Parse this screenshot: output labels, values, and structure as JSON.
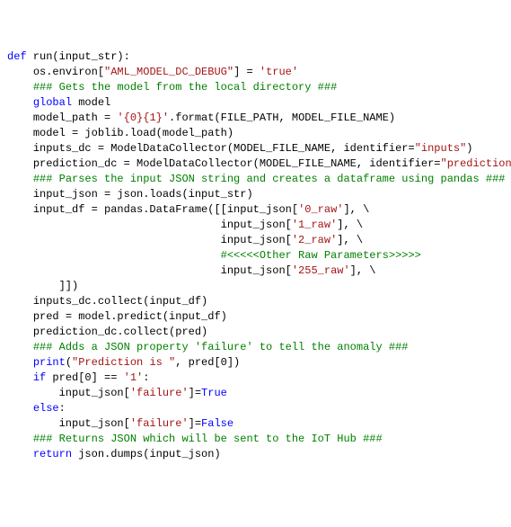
{
  "code": {
    "lines": [
      {
        "indent": 0,
        "segments": [
          {
            "cls": "kw",
            "t": "def"
          },
          {
            "cls": "",
            "t": " run(input_str):"
          }
        ]
      },
      {
        "indent": 1,
        "segments": [
          {
            "cls": "",
            "t": "os.environ["
          },
          {
            "cls": "str",
            "t": "\"AML_MODEL_DC_DEBUG\""
          },
          {
            "cls": "",
            "t": "] = "
          },
          {
            "cls": "str",
            "t": "'true'"
          }
        ]
      },
      {
        "indent": 0,
        "segments": [
          {
            "cls": "",
            "t": ""
          }
        ]
      },
      {
        "indent": 1,
        "segments": [
          {
            "cls": "cmt",
            "t": "### Gets the model from the local directory ###"
          }
        ]
      },
      {
        "indent": 1,
        "segments": [
          {
            "cls": "kw",
            "t": "global"
          },
          {
            "cls": "",
            "t": " model"
          }
        ]
      },
      {
        "indent": 1,
        "segments": [
          {
            "cls": "",
            "t": "model_path = "
          },
          {
            "cls": "str",
            "t": "'{0}{1}'"
          },
          {
            "cls": "",
            "t": ".format(FILE_PATH, MODEL_FILE_NAME)"
          }
        ]
      },
      {
        "indent": 1,
        "segments": [
          {
            "cls": "",
            "t": "model = joblib.load(model_path)"
          }
        ]
      },
      {
        "indent": 1,
        "segments": [
          {
            "cls": "",
            "t": "inputs_dc = ModelDataCollector(MODEL_FILE_NAME, identifier="
          },
          {
            "cls": "str",
            "t": "\"inputs\""
          },
          {
            "cls": "",
            "t": ")"
          }
        ]
      },
      {
        "indent": 1,
        "segments": [
          {
            "cls": "",
            "t": "prediction_dc = ModelDataCollector(MODEL_FILE_NAME, identifier="
          },
          {
            "cls": "str",
            "t": "\"prediction\""
          },
          {
            "cls": "",
            "t": ")"
          }
        ]
      },
      {
        "indent": 0,
        "segments": [
          {
            "cls": "",
            "t": ""
          }
        ]
      },
      {
        "indent": 1,
        "segments": [
          {
            "cls": "cmt",
            "t": "### Parses the input JSON string and creates a dataframe using pandas ###"
          }
        ]
      },
      {
        "indent": 1,
        "segments": [
          {
            "cls": "",
            "t": "input_json = json.loads(input_str)"
          }
        ]
      },
      {
        "indent": 1,
        "segments": [
          {
            "cls": "",
            "t": "input_df = pandas.DataFrame([[input_json["
          },
          {
            "cls": "str",
            "t": "'0_raw'"
          },
          {
            "cls": "",
            "t": "], \\"
          }
        ]
      },
      {
        "indent": 0,
        "segments": [
          {
            "cls": "",
            "t": "                                 input_json["
          },
          {
            "cls": "str",
            "t": "'1_raw'"
          },
          {
            "cls": "",
            "t": "], \\"
          }
        ]
      },
      {
        "indent": 0,
        "segments": [
          {
            "cls": "",
            "t": "                                 input_json["
          },
          {
            "cls": "str",
            "t": "'2_raw'"
          },
          {
            "cls": "",
            "t": "], \\"
          }
        ]
      },
      {
        "indent": 0,
        "segments": [
          {
            "cls": "",
            "t": "                                 "
          },
          {
            "cls": "cmt",
            "t": "#<<<<<Other Raw Parameters>>>>>"
          }
        ]
      },
      {
        "indent": 0,
        "segments": [
          {
            "cls": "",
            "t": "                                 input_json["
          },
          {
            "cls": "str",
            "t": "'255_raw'"
          },
          {
            "cls": "",
            "t": "], \\"
          }
        ]
      },
      {
        "indent": 2,
        "segments": [
          {
            "cls": "",
            "t": "]])"
          }
        ]
      },
      {
        "indent": 0,
        "segments": [
          {
            "cls": "",
            "t": ""
          }
        ]
      },
      {
        "indent": 1,
        "segments": [
          {
            "cls": "",
            "t": "inputs_dc.collect(input_df)"
          }
        ]
      },
      {
        "indent": 0,
        "segments": [
          {
            "cls": "",
            "t": ""
          }
        ]
      },
      {
        "indent": 1,
        "segments": [
          {
            "cls": "",
            "t": "pred = model.predict(input_df)"
          }
        ]
      },
      {
        "indent": 1,
        "segments": [
          {
            "cls": "",
            "t": "prediction_dc.collect(pred)"
          }
        ]
      },
      {
        "indent": 0,
        "segments": [
          {
            "cls": "",
            "t": ""
          }
        ]
      },
      {
        "indent": 1,
        "segments": [
          {
            "cls": "cmt",
            "t": "### Adds a JSON property 'failure' to tell the anomaly ###"
          }
        ]
      },
      {
        "indent": 1,
        "segments": [
          {
            "cls": "kw",
            "t": "print"
          },
          {
            "cls": "",
            "t": "("
          },
          {
            "cls": "str",
            "t": "\"Prediction is \""
          },
          {
            "cls": "",
            "t": ", pred[0])"
          }
        ]
      },
      {
        "indent": 1,
        "segments": [
          {
            "cls": "kw",
            "t": "if"
          },
          {
            "cls": "",
            "t": " pred[0] == "
          },
          {
            "cls": "str",
            "t": "'1'"
          },
          {
            "cls": "",
            "t": ":"
          }
        ]
      },
      {
        "indent": 2,
        "segments": [
          {
            "cls": "",
            "t": "input_json["
          },
          {
            "cls": "str",
            "t": "'failure'"
          },
          {
            "cls": "",
            "t": "]="
          },
          {
            "cls": "bool",
            "t": "True"
          }
        ]
      },
      {
        "indent": 1,
        "segments": [
          {
            "cls": "kw",
            "t": "else"
          },
          {
            "cls": "",
            "t": ":"
          }
        ]
      },
      {
        "indent": 2,
        "segments": [
          {
            "cls": "",
            "t": "input_json["
          },
          {
            "cls": "str",
            "t": "'failure'"
          },
          {
            "cls": "",
            "t": "]="
          },
          {
            "cls": "bool",
            "t": "False"
          }
        ]
      },
      {
        "indent": 0,
        "segments": [
          {
            "cls": "",
            "t": ""
          }
        ]
      },
      {
        "indent": 1,
        "segments": [
          {
            "cls": "cmt",
            "t": "### Returns JSON which will be sent to the IoT Hub ###"
          }
        ]
      },
      {
        "indent": 1,
        "segments": [
          {
            "cls": "kw",
            "t": "return"
          },
          {
            "cls": "",
            "t": " json.dumps(input_json)"
          }
        ]
      }
    ]
  },
  "indentUnit": "    "
}
